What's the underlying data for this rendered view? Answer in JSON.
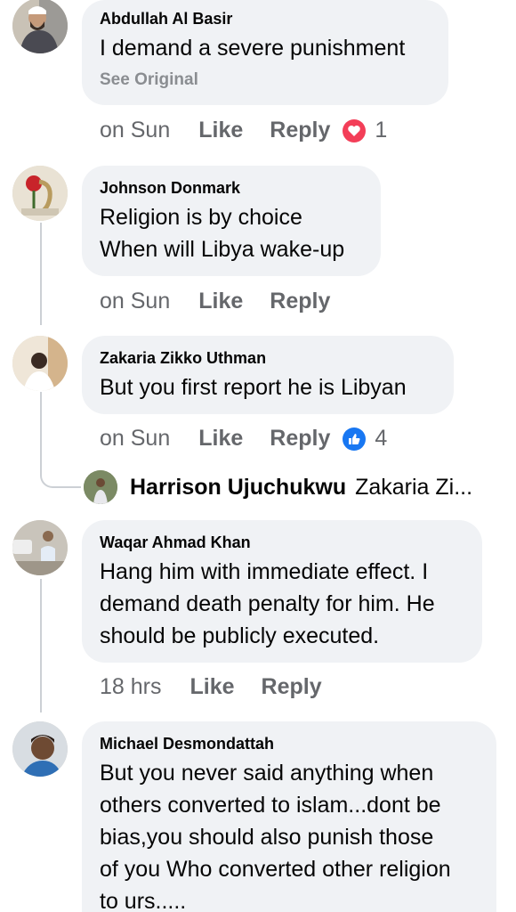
{
  "comments": [
    {
      "author": "Abdullah Al Basir",
      "lines": [
        "I demand a severe punishment"
      ],
      "see_original": "See Original",
      "time": "on Sun",
      "like": "Like",
      "reply": "Reply",
      "reaction": {
        "icon": "heart-reaction-icon",
        "count": "1",
        "color": "#f33e58"
      }
    },
    {
      "author": "Johnson Donmark",
      "lines": [
        "Religion is by choice",
        "When will Libya wake-up"
      ],
      "time": "on Sun",
      "like": "Like",
      "reply": "Reply"
    },
    {
      "author": "Zakaria Zikko Uthman",
      "lines": [
        "But you first report he is Libyan"
      ],
      "time": "on Sun",
      "like": "Like",
      "reply": "Reply",
      "reaction": {
        "icon": "thumbs-up-reaction-icon",
        "count": "4",
        "color": "#1877f2"
      },
      "reply_preview": {
        "author": "Harrison Ujuchukwu",
        "snippet": "Zakaria Zi..."
      }
    },
    {
      "author": "Waqar Ahmad Khan",
      "lines": [
        "Hang him with immediate effect. I",
        "demand death penalty for him. He",
        "should be publicly executed."
      ],
      "time": "18 hrs",
      "like": "Like",
      "reply": "Reply"
    },
    {
      "author": "Michael Desmondattah",
      "lines": [
        "But you never said anything when",
        "others converted to islam...dont be",
        "bias,you should also punish those",
        "of you Who converted other religion",
        "to urs....."
      ]
    }
  ]
}
